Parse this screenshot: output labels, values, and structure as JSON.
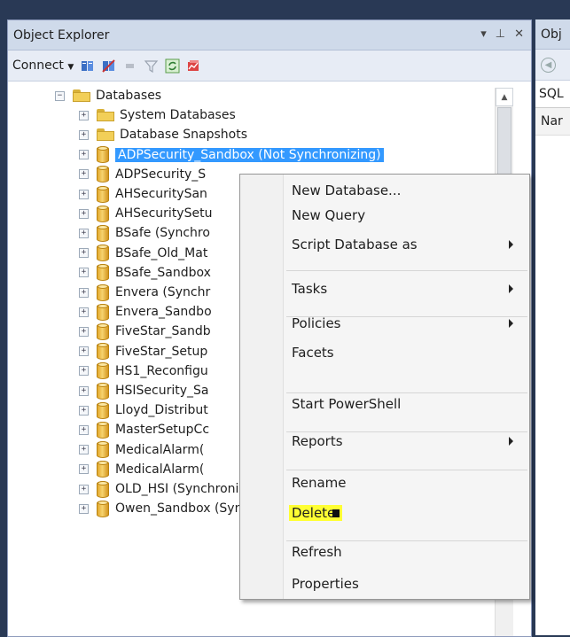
{
  "object_explorer": {
    "title": "Object Explorer",
    "pin_glyph": "▾ ⊥ ✕",
    "connect_label": "Connect",
    "tree": [
      {
        "label": "Databases",
        "type": "folder",
        "expander": "−",
        "indent": 0
      },
      {
        "label": "System Databases",
        "type": "folder",
        "expander": "+",
        "indent": 1
      },
      {
        "label": "Database Snapshots",
        "type": "folder",
        "expander": "+",
        "indent": 1
      },
      {
        "label": "ADPSecurity_Sandbox (Not Synchronizing)",
        "type": "db",
        "expander": "+",
        "indent": 1,
        "selected": true
      },
      {
        "label": "ADPSecurity_S",
        "type": "db",
        "expander": "+",
        "indent": 1
      },
      {
        "label": "AHSecuritySan",
        "type": "db",
        "expander": "+",
        "indent": 1
      },
      {
        "label": "AHSecuritySetu",
        "type": "db",
        "expander": "+",
        "indent": 1
      },
      {
        "label": "BSafe (Synchro",
        "type": "db",
        "expander": "+",
        "indent": 1
      },
      {
        "label": "BSafe_Old_Mat",
        "type": "db",
        "expander": "+",
        "indent": 1
      },
      {
        "label": "BSafe_Sandbox",
        "type": "db",
        "expander": "+",
        "indent": 1
      },
      {
        "label": "Envera (Synchr",
        "type": "db",
        "expander": "+",
        "indent": 1
      },
      {
        "label": "Envera_Sandbo",
        "type": "db",
        "expander": "+",
        "indent": 1
      },
      {
        "label": "FiveStar_Sandb",
        "type": "db",
        "expander": "+",
        "indent": 1
      },
      {
        "label": "FiveStar_Setup",
        "type": "db",
        "expander": "+",
        "indent": 1
      },
      {
        "label": "HS1_Reconfigu",
        "type": "db",
        "expander": "+",
        "indent": 1
      },
      {
        "label": "HSISecurity_Sa",
        "type": "db",
        "expander": "+",
        "indent": 1
      },
      {
        "label": "Lloyd_Distribut",
        "type": "db",
        "expander": "+",
        "indent": 1
      },
      {
        "label": "MasterSetupCc",
        "type": "db",
        "expander": "+",
        "indent": 1
      },
      {
        "label": "MedicalAlarm(",
        "type": "db",
        "expander": "+",
        "indent": 1
      },
      {
        "label": "MedicalAlarm(",
        "type": "db",
        "expander": "+",
        "indent": 1
      },
      {
        "label": "OLD_HSI (Synchronized)",
        "type": "db",
        "expander": "+",
        "indent": 1
      },
      {
        "label": "Owen_Sandbox (Synchronized)",
        "type": "db",
        "expander": "+",
        "indent": 1
      }
    ]
  },
  "object_details": {
    "title": "Obj",
    "sql_label": "SQL",
    "name_col": "Nar"
  },
  "context_menu": {
    "items": [
      {
        "label": "New Database...",
        "submenu": false
      },
      {
        "label": "New Query",
        "submenu": false
      },
      {
        "label": "Script Database as",
        "submenu": true
      },
      {
        "sep": true
      },
      {
        "label": "Tasks",
        "submenu": true
      },
      {
        "sep": true
      },
      {
        "label": "Policies",
        "submenu": true
      },
      {
        "label": "Facets",
        "submenu": false
      },
      {
        "sep": true
      },
      {
        "label": "Start PowerShell",
        "submenu": false
      },
      {
        "sep": true
      },
      {
        "label": "Reports",
        "submenu": true
      },
      {
        "sep": true
      },
      {
        "label": "Rename",
        "submenu": false
      },
      {
        "label": "Delete",
        "submenu": false,
        "highlight": true
      },
      {
        "sep": true
      },
      {
        "label": "Refresh",
        "submenu": false
      },
      {
        "label": "Properties",
        "submenu": false
      }
    ]
  },
  "colors": {
    "selection": "#3399ff",
    "highlight": "#ffff33",
    "frame": "#293955"
  }
}
